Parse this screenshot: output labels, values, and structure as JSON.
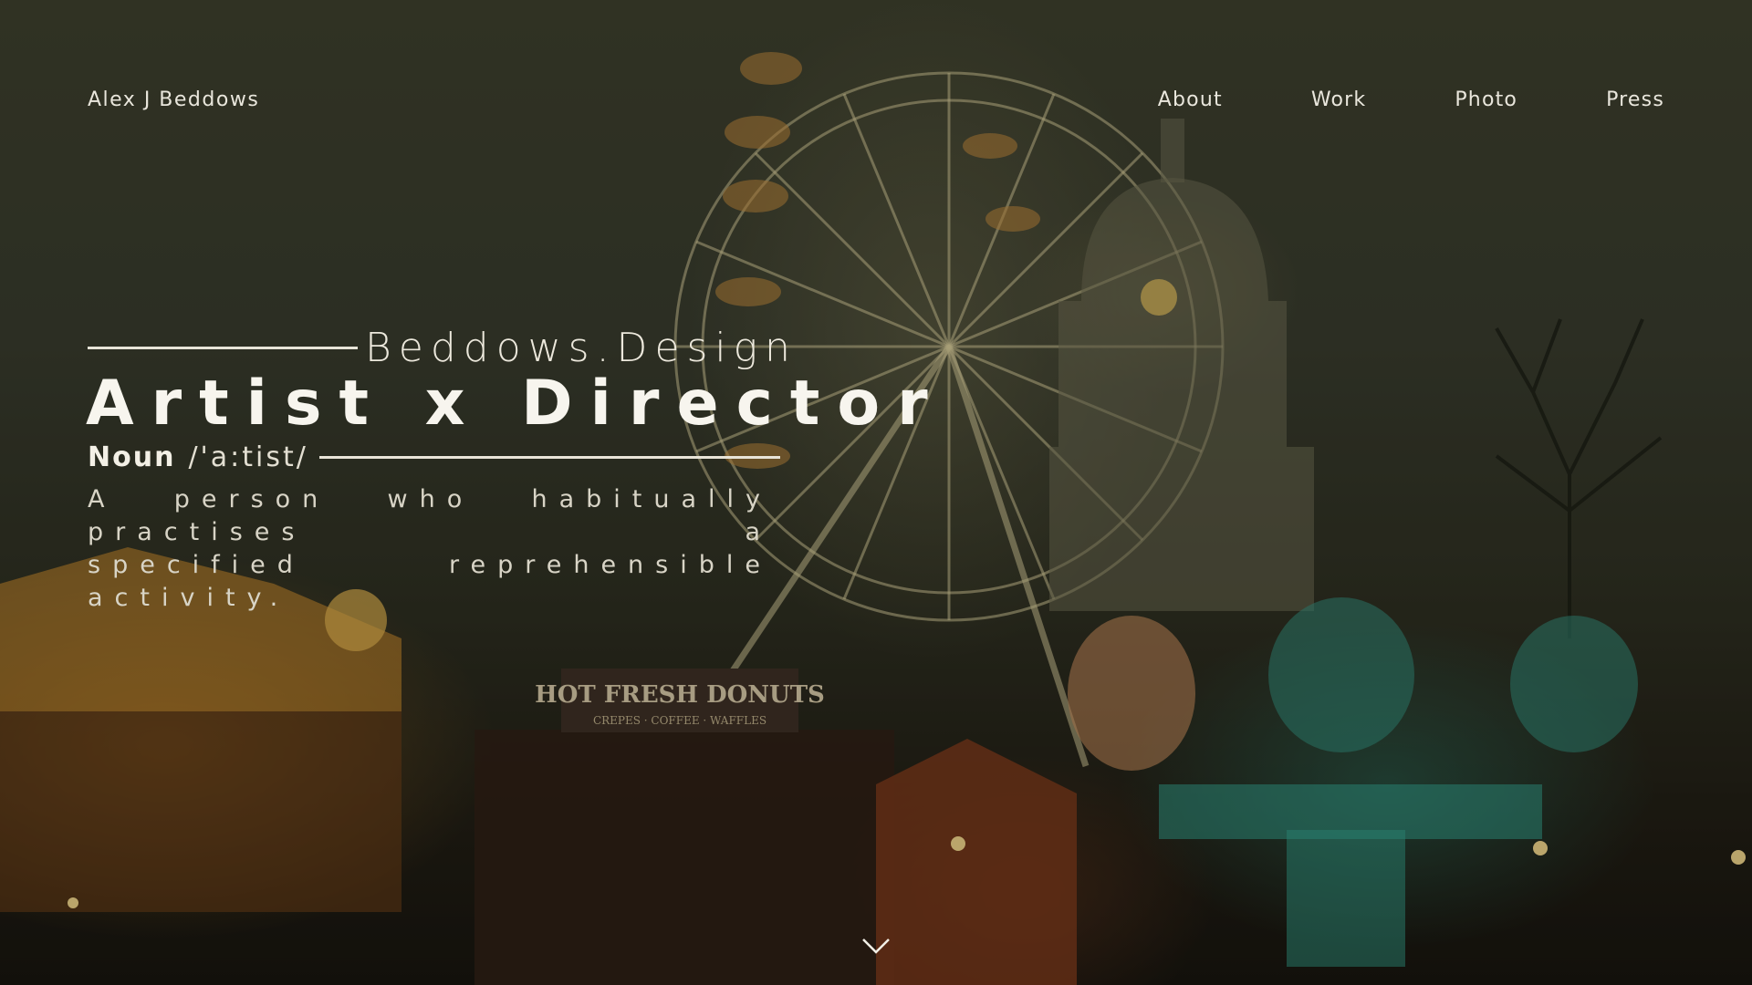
{
  "header": {
    "brand": "Alex J Beddows",
    "nav": [
      {
        "label": "About"
      },
      {
        "label": "Work"
      },
      {
        "label": "Photo"
      },
      {
        "label": "Press"
      }
    ]
  },
  "hero": {
    "kicker": "Beddows.Design",
    "headline": "Artist x Director",
    "part_of_speech": "Noun",
    "pronunciation": "/'a:tist/",
    "definition_line_1": "A person who habitually practises a",
    "definition_line_2": "specified reprehensible activity."
  },
  "background": {
    "sign_text": "HOT FRESH DONUTS",
    "sign_subtext": "CREPES · COFFEE · WAFFLES"
  },
  "scroll": {
    "icon": "chevron-down-icon"
  },
  "colors": {
    "text": "#e9e6dc",
    "headline": "#f7f5ee",
    "accent_warm": "#d9a24a",
    "accent_teal": "#2fa38f"
  }
}
